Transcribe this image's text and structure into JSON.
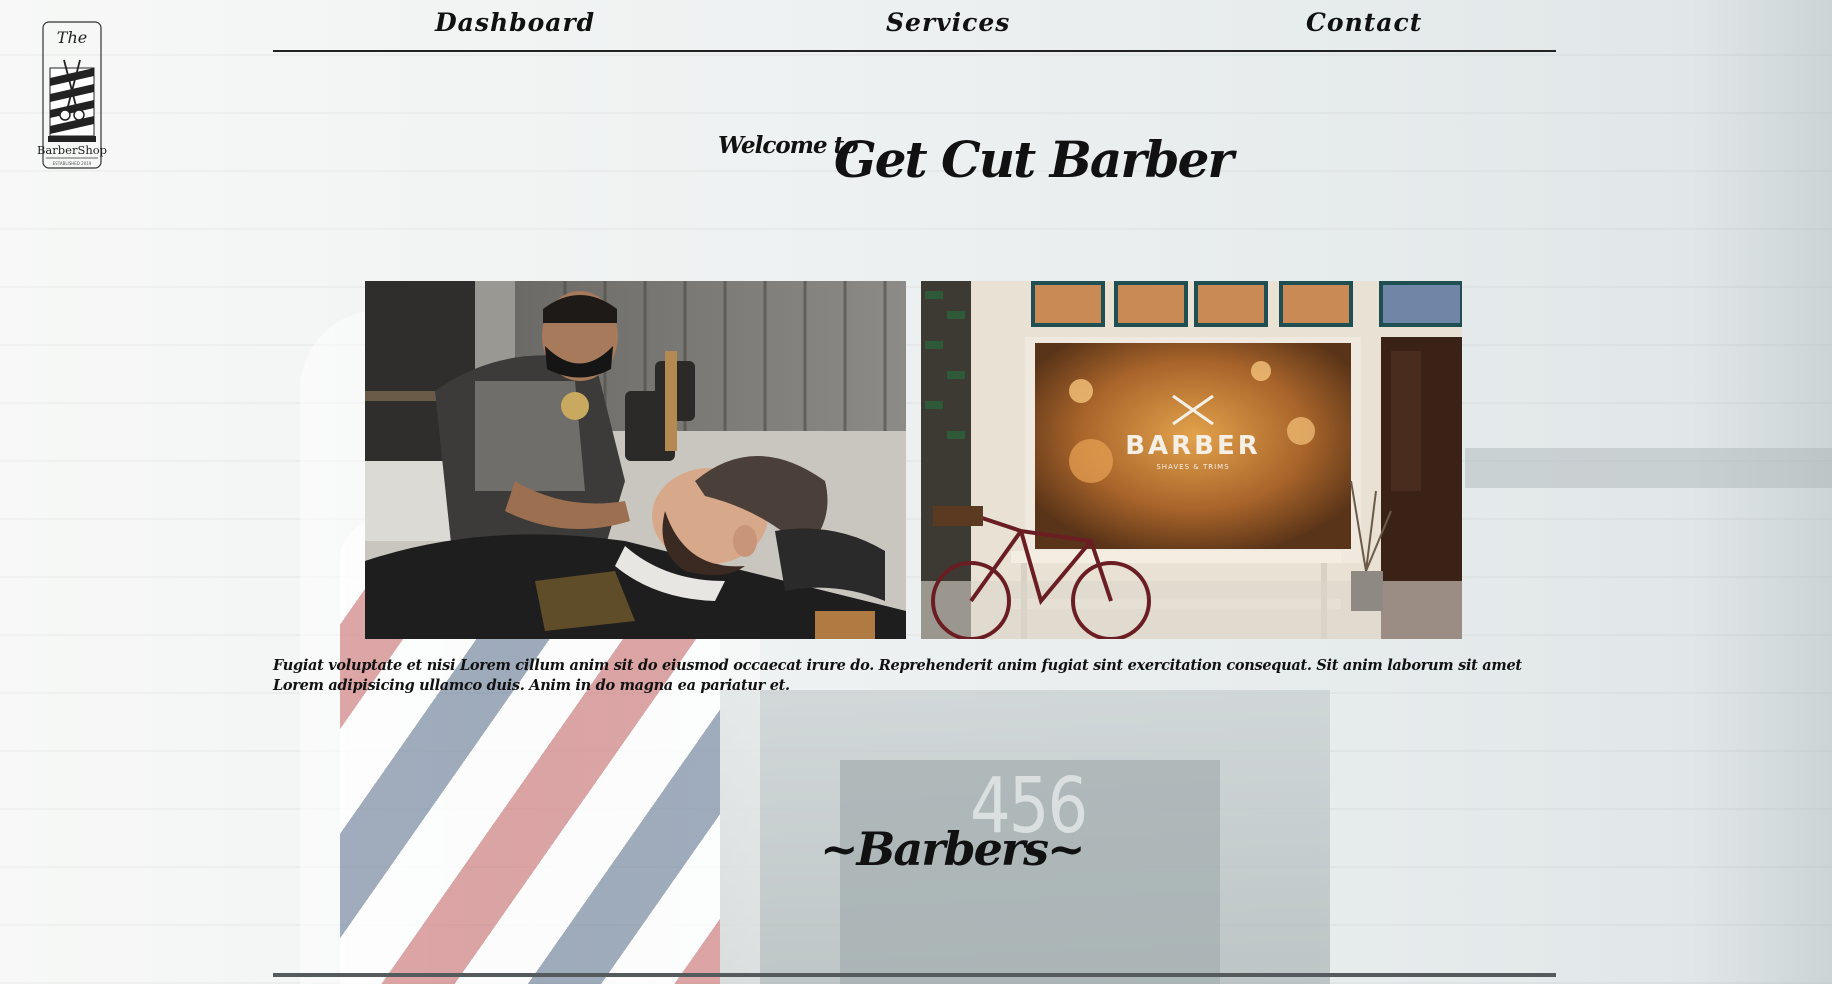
{
  "logo": {
    "top_text": "The",
    "name": "BarberShop",
    "tagline": "ESTABLISHED 2019"
  },
  "nav": {
    "items": [
      "Dashboard",
      "Services",
      "Contact"
    ]
  },
  "hero": {
    "welcome": "Welcome to",
    "title": "Get Cut Barber"
  },
  "photos": {
    "left_icon": "barber-at-work-photo",
    "right_icon": "barbershop-storefront-photo",
    "storefront_sign": "BARBER",
    "storefront_subsign": "SHAVES & TRIMS"
  },
  "intro": {
    "text": "Fugiat voluptate et nisi Lorem cillum anim sit do eiusmod occaecat irure do. Reprehenderit anim fugiat sint exercitation consequat. Sit anim laborum sit amet Lorem adipisicing ullamco duis. Anim in do magna ea pariatur et."
  },
  "barbers": {
    "title": "~Barbers~"
  },
  "background": {
    "house_number": "456"
  },
  "colors": {
    "text": "#111111",
    "rule": "#222222"
  }
}
